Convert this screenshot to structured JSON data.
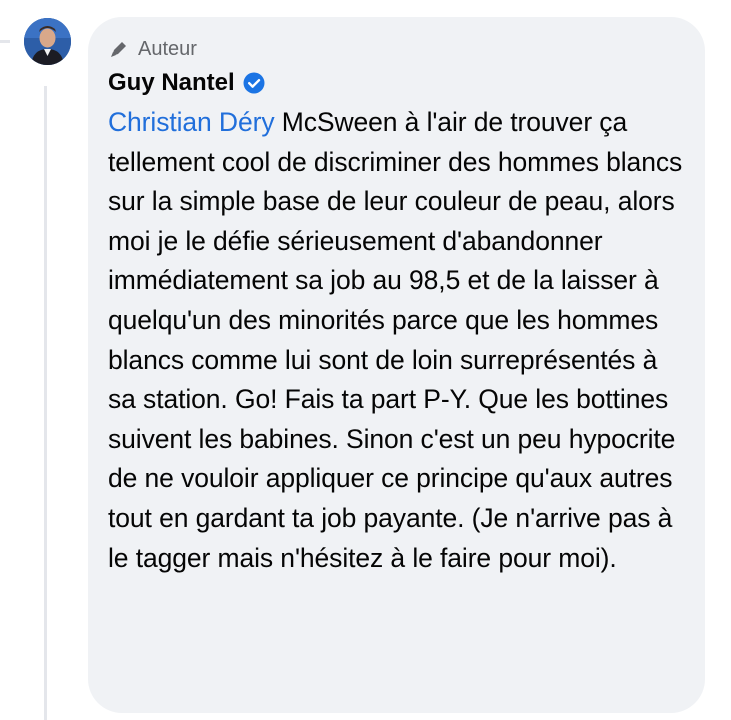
{
  "comment": {
    "role_label": "Auteur",
    "role_icon": "pen-icon",
    "author_name": "Guy Nantel",
    "verified_icon": "verified-badge-icon",
    "mention": "Christian Déry",
    "body": "McSween à l'air de trouver ça tellement cool de discriminer des hommes blancs sur la simple base de leur couleur de peau, alors moi je le défie sérieusement d'abandonner immédiatement sa job au 98,5 et de la laisser à quelqu'un des minorités parce que les hommes blancs comme lui sont de loin surreprésentés à sa station. Go! Fais ta part P-Y. Que les bottines suivent les babines. Sinon c'est un peu hypocrite de ne vouloir appliquer ce principe qu'aux autres tout en gardant ta job payante. (Je n'arrive pas à le tagger mais n'hésitez à le faire pour moi)."
  },
  "colors": {
    "bubble_bg": "#f0f2f5",
    "mention": "#216fdb",
    "verified": "#1b74e4",
    "secondary_text": "#65676b"
  }
}
